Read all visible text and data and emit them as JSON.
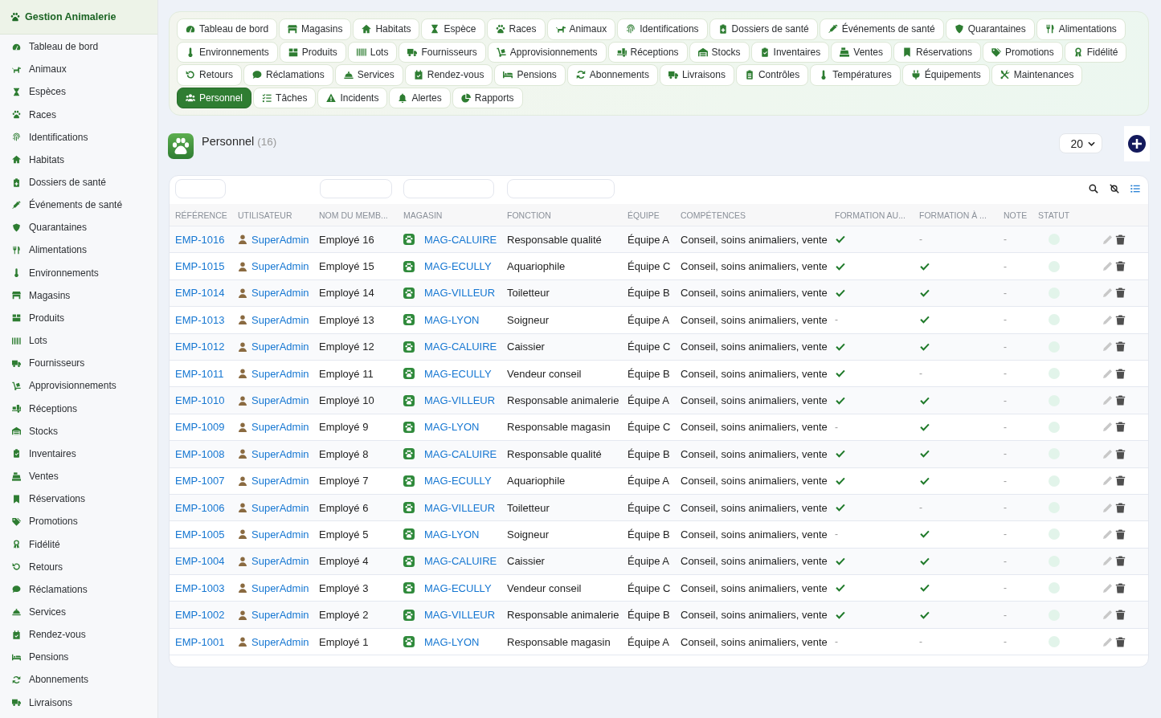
{
  "sidebar": {
    "brand": "Gestion Animalerie",
    "items": [
      "Tableau de bord",
      "Animaux",
      "Espèces",
      "Races",
      "Identifications",
      "Habitats",
      "Dossiers de santé",
      "Événements de santé",
      "Quarantaines",
      "Alimentations",
      "Environnements",
      "Magasins",
      "Produits",
      "Lots",
      "Fournisseurs",
      "Approvisionnements",
      "Réceptions",
      "Stocks",
      "Inventaires",
      "Ventes",
      "Réservations",
      "Promotions",
      "Fidélité",
      "Retours",
      "Réclamations",
      "Services",
      "Rendez-vous",
      "Pensions",
      "Abonnements",
      "Livraisons"
    ]
  },
  "tabs": [
    {
      "label": "Tableau de bord",
      "selected": false
    },
    {
      "label": "Magasins",
      "selected": false
    },
    {
      "label": "Habitats",
      "selected": false
    },
    {
      "label": "Espèce",
      "selected": false
    },
    {
      "label": "Races",
      "selected": false
    },
    {
      "label": "Animaux",
      "selected": false
    },
    {
      "label": "Identifications",
      "selected": false
    },
    {
      "label": "Dossiers de santé",
      "selected": false
    },
    {
      "label": "Événements de santé",
      "selected": false
    },
    {
      "label": "Quarantaines",
      "selected": false
    },
    {
      "label": "Alimentations",
      "selected": false
    },
    {
      "label": "Environnements",
      "selected": false
    },
    {
      "label": "Produits",
      "selected": false
    },
    {
      "label": "Lots",
      "selected": false
    },
    {
      "label": "Fournisseurs",
      "selected": false
    },
    {
      "label": "Approvisionnements",
      "selected": false
    },
    {
      "label": "Réceptions",
      "selected": false
    },
    {
      "label": "Stocks",
      "selected": false
    },
    {
      "label": "Inventaires",
      "selected": false
    },
    {
      "label": "Ventes",
      "selected": false
    },
    {
      "label": "Réservations",
      "selected": false
    },
    {
      "label": "Promotions",
      "selected": false
    },
    {
      "label": "Fidélité",
      "selected": false
    },
    {
      "label": "Retours",
      "selected": false
    },
    {
      "label": "Réclamations",
      "selected": false
    },
    {
      "label": "Services",
      "selected": false
    },
    {
      "label": "Rendez-vous",
      "selected": false
    },
    {
      "label": "Pensions",
      "selected": false
    },
    {
      "label": "Abonnements",
      "selected": false
    },
    {
      "label": "Livraisons",
      "selected": false
    },
    {
      "label": "Contrôles",
      "selected": false
    },
    {
      "label": "Températures",
      "selected": false
    },
    {
      "label": "Équipements",
      "selected": false
    },
    {
      "label": "Maintenances",
      "selected": false
    },
    {
      "label": "Personnel",
      "selected": true
    },
    {
      "label": "Tâches",
      "selected": false
    },
    {
      "label": "Incidents",
      "selected": false
    },
    {
      "label": "Alertes",
      "selected": false
    },
    {
      "label": "Rapports",
      "selected": false
    }
  ],
  "page_header": {
    "title": "Personnel",
    "count": "(16)",
    "page_size": "20"
  },
  "table": {
    "columns": [
      "RÉFÉRENCE",
      "UTILISATEUR",
      "NOM DU MEMB...",
      "MAGASIN",
      "FONCTION",
      "ÉQUIPE",
      "COMPÉTENCES",
      "FORMATION AU...",
      "FORMATION À ...",
      "NOTE",
      "STATUT"
    ],
    "rows": [
      {
        "reference": "EMP-1016",
        "utilisateur": "SuperAdmin",
        "column_3": "Employé 16",
        "magasin": "MAG-CALUIRE",
        "fonction": "Responsable qualité",
        "equipe": "Équipe A",
        "competences": "Conseil, soins animaliers, vente",
        "column_8": {
          "checked": true
        },
        "column_9": {
          "checked": false,
          "text": "-"
        },
        "note": "-"
      },
      {
        "reference": "EMP-1015",
        "utilisateur": "SuperAdmin",
        "column_3": "Employé 15",
        "magasin": "MAG-ECULLY",
        "fonction": "Aquariophile",
        "equipe": "Équipe C",
        "competences": "Conseil, soins animaliers, vente",
        "column_8": {
          "checked": true
        },
        "column_9": {
          "checked": true
        },
        "note": "-"
      },
      {
        "reference": "EMP-1014",
        "utilisateur": "SuperAdmin",
        "column_3": "Employé 14",
        "magasin": "MAG-VILLEUR",
        "fonction": "Toiletteur",
        "equipe": "Équipe B",
        "competences": "Conseil, soins animaliers, vente",
        "column_8": {
          "checked": true
        },
        "column_9": {
          "checked": true
        },
        "note": "-"
      },
      {
        "reference": "EMP-1013",
        "utilisateur": "SuperAdmin",
        "column_3": "Employé 13",
        "magasin": "MAG-LYON",
        "fonction": "Soigneur",
        "equipe": "Équipe A",
        "competences": "Conseil, soins animaliers, vente",
        "column_8": {
          "checked": false,
          "text": "-"
        },
        "column_9": {
          "checked": true
        },
        "note": "-"
      },
      {
        "reference": "EMP-1012",
        "utilisateur": "SuperAdmin",
        "column_3": "Employé 12",
        "magasin": "MAG-CALUIRE",
        "fonction": "Caissier",
        "equipe": "Équipe C",
        "competences": "Conseil, soins animaliers, vente",
        "column_8": {
          "checked": true
        },
        "column_9": {
          "checked": true
        },
        "note": "-"
      },
      {
        "reference": "EMP-1011",
        "utilisateur": "SuperAdmin",
        "column_3": "Employé 11",
        "magasin": "MAG-ECULLY",
        "fonction": "Vendeur conseil",
        "equipe": "Équipe B",
        "competences": "Conseil, soins animaliers, vente",
        "column_8": {
          "checked": true
        },
        "column_9": {
          "checked": false,
          "text": "-"
        },
        "note": "-"
      },
      {
        "reference": "EMP-1010",
        "utilisateur": "SuperAdmin",
        "column_3": "Employé 10",
        "magasin": "MAG-VILLEUR",
        "fonction": "Responsable animalerie",
        "equipe": "Équipe A",
        "competences": "Conseil, soins animaliers, vente",
        "column_8": {
          "checked": true
        },
        "column_9": {
          "checked": true
        },
        "note": "-"
      },
      {
        "reference": "EMP-1009",
        "utilisateur": "SuperAdmin",
        "column_3": "Employé 9",
        "magasin": "MAG-LYON",
        "fonction": "Responsable magasin",
        "equipe": "Équipe C",
        "competences": "Conseil, soins animaliers, vente",
        "column_8": {
          "checked": false,
          "text": "-"
        },
        "column_9": {
          "checked": true
        },
        "note": "-"
      },
      {
        "reference": "EMP-1008",
        "utilisateur": "SuperAdmin",
        "column_3": "Employé 8",
        "magasin": "MAG-CALUIRE",
        "fonction": "Responsable qualité",
        "equipe": "Équipe B",
        "competences": "Conseil, soins animaliers, vente",
        "column_8": {
          "checked": true
        },
        "column_9": {
          "checked": true
        },
        "note": "-"
      },
      {
        "reference": "EMP-1007",
        "utilisateur": "SuperAdmin",
        "column_3": "Employé 7",
        "magasin": "MAG-ECULLY",
        "fonction": "Aquariophile",
        "equipe": "Équipe A",
        "competences": "Conseil, soins animaliers, vente",
        "column_8": {
          "checked": true
        },
        "column_9": {
          "checked": true
        },
        "note": "-"
      },
      {
        "reference": "EMP-1006",
        "utilisateur": "SuperAdmin",
        "column_3": "Employé 6",
        "magasin": "MAG-VILLEUR",
        "fonction": "Toiletteur",
        "equipe": "Équipe C",
        "competences": "Conseil, soins animaliers, vente",
        "column_8": {
          "checked": true
        },
        "column_9": {
          "checked": false,
          "text": "-"
        },
        "note": "-"
      },
      {
        "reference": "EMP-1005",
        "utilisateur": "SuperAdmin",
        "column_3": "Employé 5",
        "magasin": "MAG-LYON",
        "fonction": "Soigneur",
        "equipe": "Équipe B",
        "competences": "Conseil, soins animaliers, vente",
        "column_8": {
          "checked": false,
          "text": "-"
        },
        "column_9": {
          "checked": true
        },
        "note": "-"
      },
      {
        "reference": "EMP-1004",
        "utilisateur": "SuperAdmin",
        "column_3": "Employé 4",
        "magasin": "MAG-CALUIRE",
        "fonction": "Caissier",
        "equipe": "Équipe A",
        "competences": "Conseil, soins animaliers, vente",
        "column_8": {
          "checked": true
        },
        "column_9": {
          "checked": true
        },
        "note": "-"
      },
      {
        "reference": "EMP-1003",
        "utilisateur": "SuperAdmin",
        "column_3": "Employé 3",
        "magasin": "MAG-ECULLY",
        "fonction": "Vendeur conseil",
        "equipe": "Équipe C",
        "competences": "Conseil, soins animaliers, vente",
        "column_8": {
          "checked": true
        },
        "column_9": {
          "checked": true
        },
        "note": "-"
      },
      {
        "reference": "EMP-1002",
        "utilisateur": "SuperAdmin",
        "column_3": "Employé 2",
        "magasin": "MAG-VILLEUR",
        "fonction": "Responsable animalerie",
        "equipe": "Équipe B",
        "competences": "Conseil, soins animaliers, vente",
        "column_8": {
          "checked": true
        },
        "column_9": {
          "checked": true
        },
        "note": "-"
      },
      {
        "reference": "EMP-1001",
        "utilisateur": "SuperAdmin",
        "column_3": "Employé 1",
        "magasin": "MAG-LYON",
        "fonction": "Responsable magasin",
        "equipe": "Équipe A",
        "competences": "Conseil, soins animaliers, vente",
        "column_8": {
          "checked": false,
          "text": "-"
        },
        "column_9": {
          "checked": false,
          "text": "-"
        },
        "note": "-"
      }
    ]
  }
}
